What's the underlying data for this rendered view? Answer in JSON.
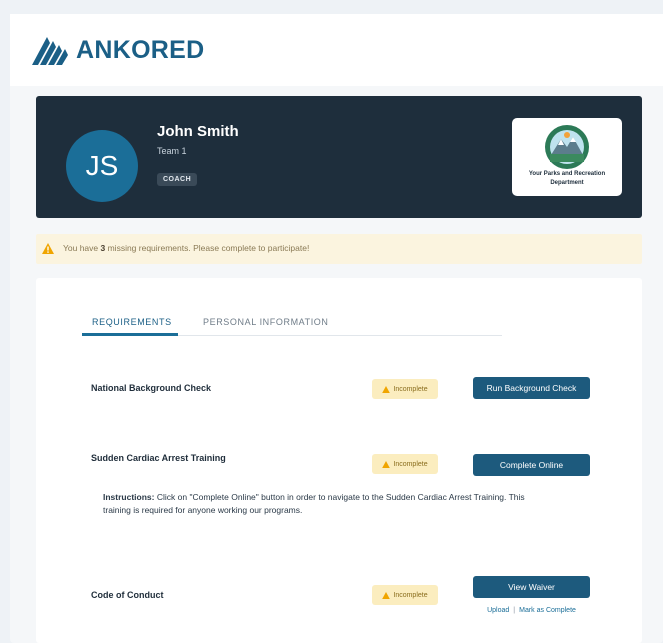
{
  "brand": {
    "name": "ANKORED",
    "color": "#1b5f86"
  },
  "profile": {
    "initials": "JS",
    "name": "John Smith",
    "team": "Team 1",
    "role": "COACH",
    "organization": "Your Parks and Recreation Department"
  },
  "alert": {
    "prefix": "You have ",
    "count": "3",
    "suffix": " missing requirements. Please complete to participate!"
  },
  "tabs": [
    {
      "label": "REQUIREMENTS",
      "active": true
    },
    {
      "label": "PERSONAL INFORMATION",
      "active": false
    }
  ],
  "requirements": [
    {
      "name": "National Background Check",
      "status": "Incomplete",
      "action": "Run Background Check"
    },
    {
      "name": "Sudden Cardiac Arrest Training",
      "status": "Incomplete",
      "action": "Complete Online",
      "instructions_label": "Instructions:",
      "instructions_text": "Click on \"Complete Online\" button in order to navigate to the Sudden Cardiac Arrest Training. This training is required for anyone working our programs."
    },
    {
      "name": "Code of Conduct",
      "status": "Incomplete",
      "action": "View Waiver",
      "links": [
        "Upload",
        "Mark as Complete"
      ]
    }
  ],
  "colors": {
    "header_bg": "#1e2e3c",
    "avatar_bg": "#1b6e98",
    "button_bg": "#1d5a7d",
    "alert_bg": "#fbf4df",
    "status_bg": "#fbedbf",
    "warning_icon": "#f0a500"
  },
  "icons": [
    "ankored-logo-icon",
    "warning-icon",
    "org-seal-icon"
  ]
}
